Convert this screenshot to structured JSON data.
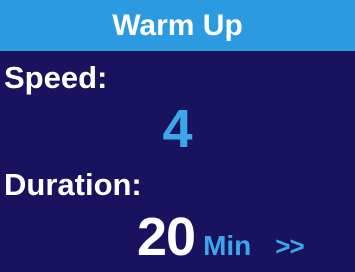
{
  "header": {
    "title": "Warm Up"
  },
  "speed": {
    "label": "Speed:",
    "value": "4"
  },
  "duration": {
    "label": "Duration:",
    "value": "20",
    "unit": "Min",
    "next": ">>"
  },
  "colors": {
    "background": "#18125f",
    "header_background": "#2b9ae0",
    "accent": "#3ba6e8",
    "text": "#ffffff"
  }
}
